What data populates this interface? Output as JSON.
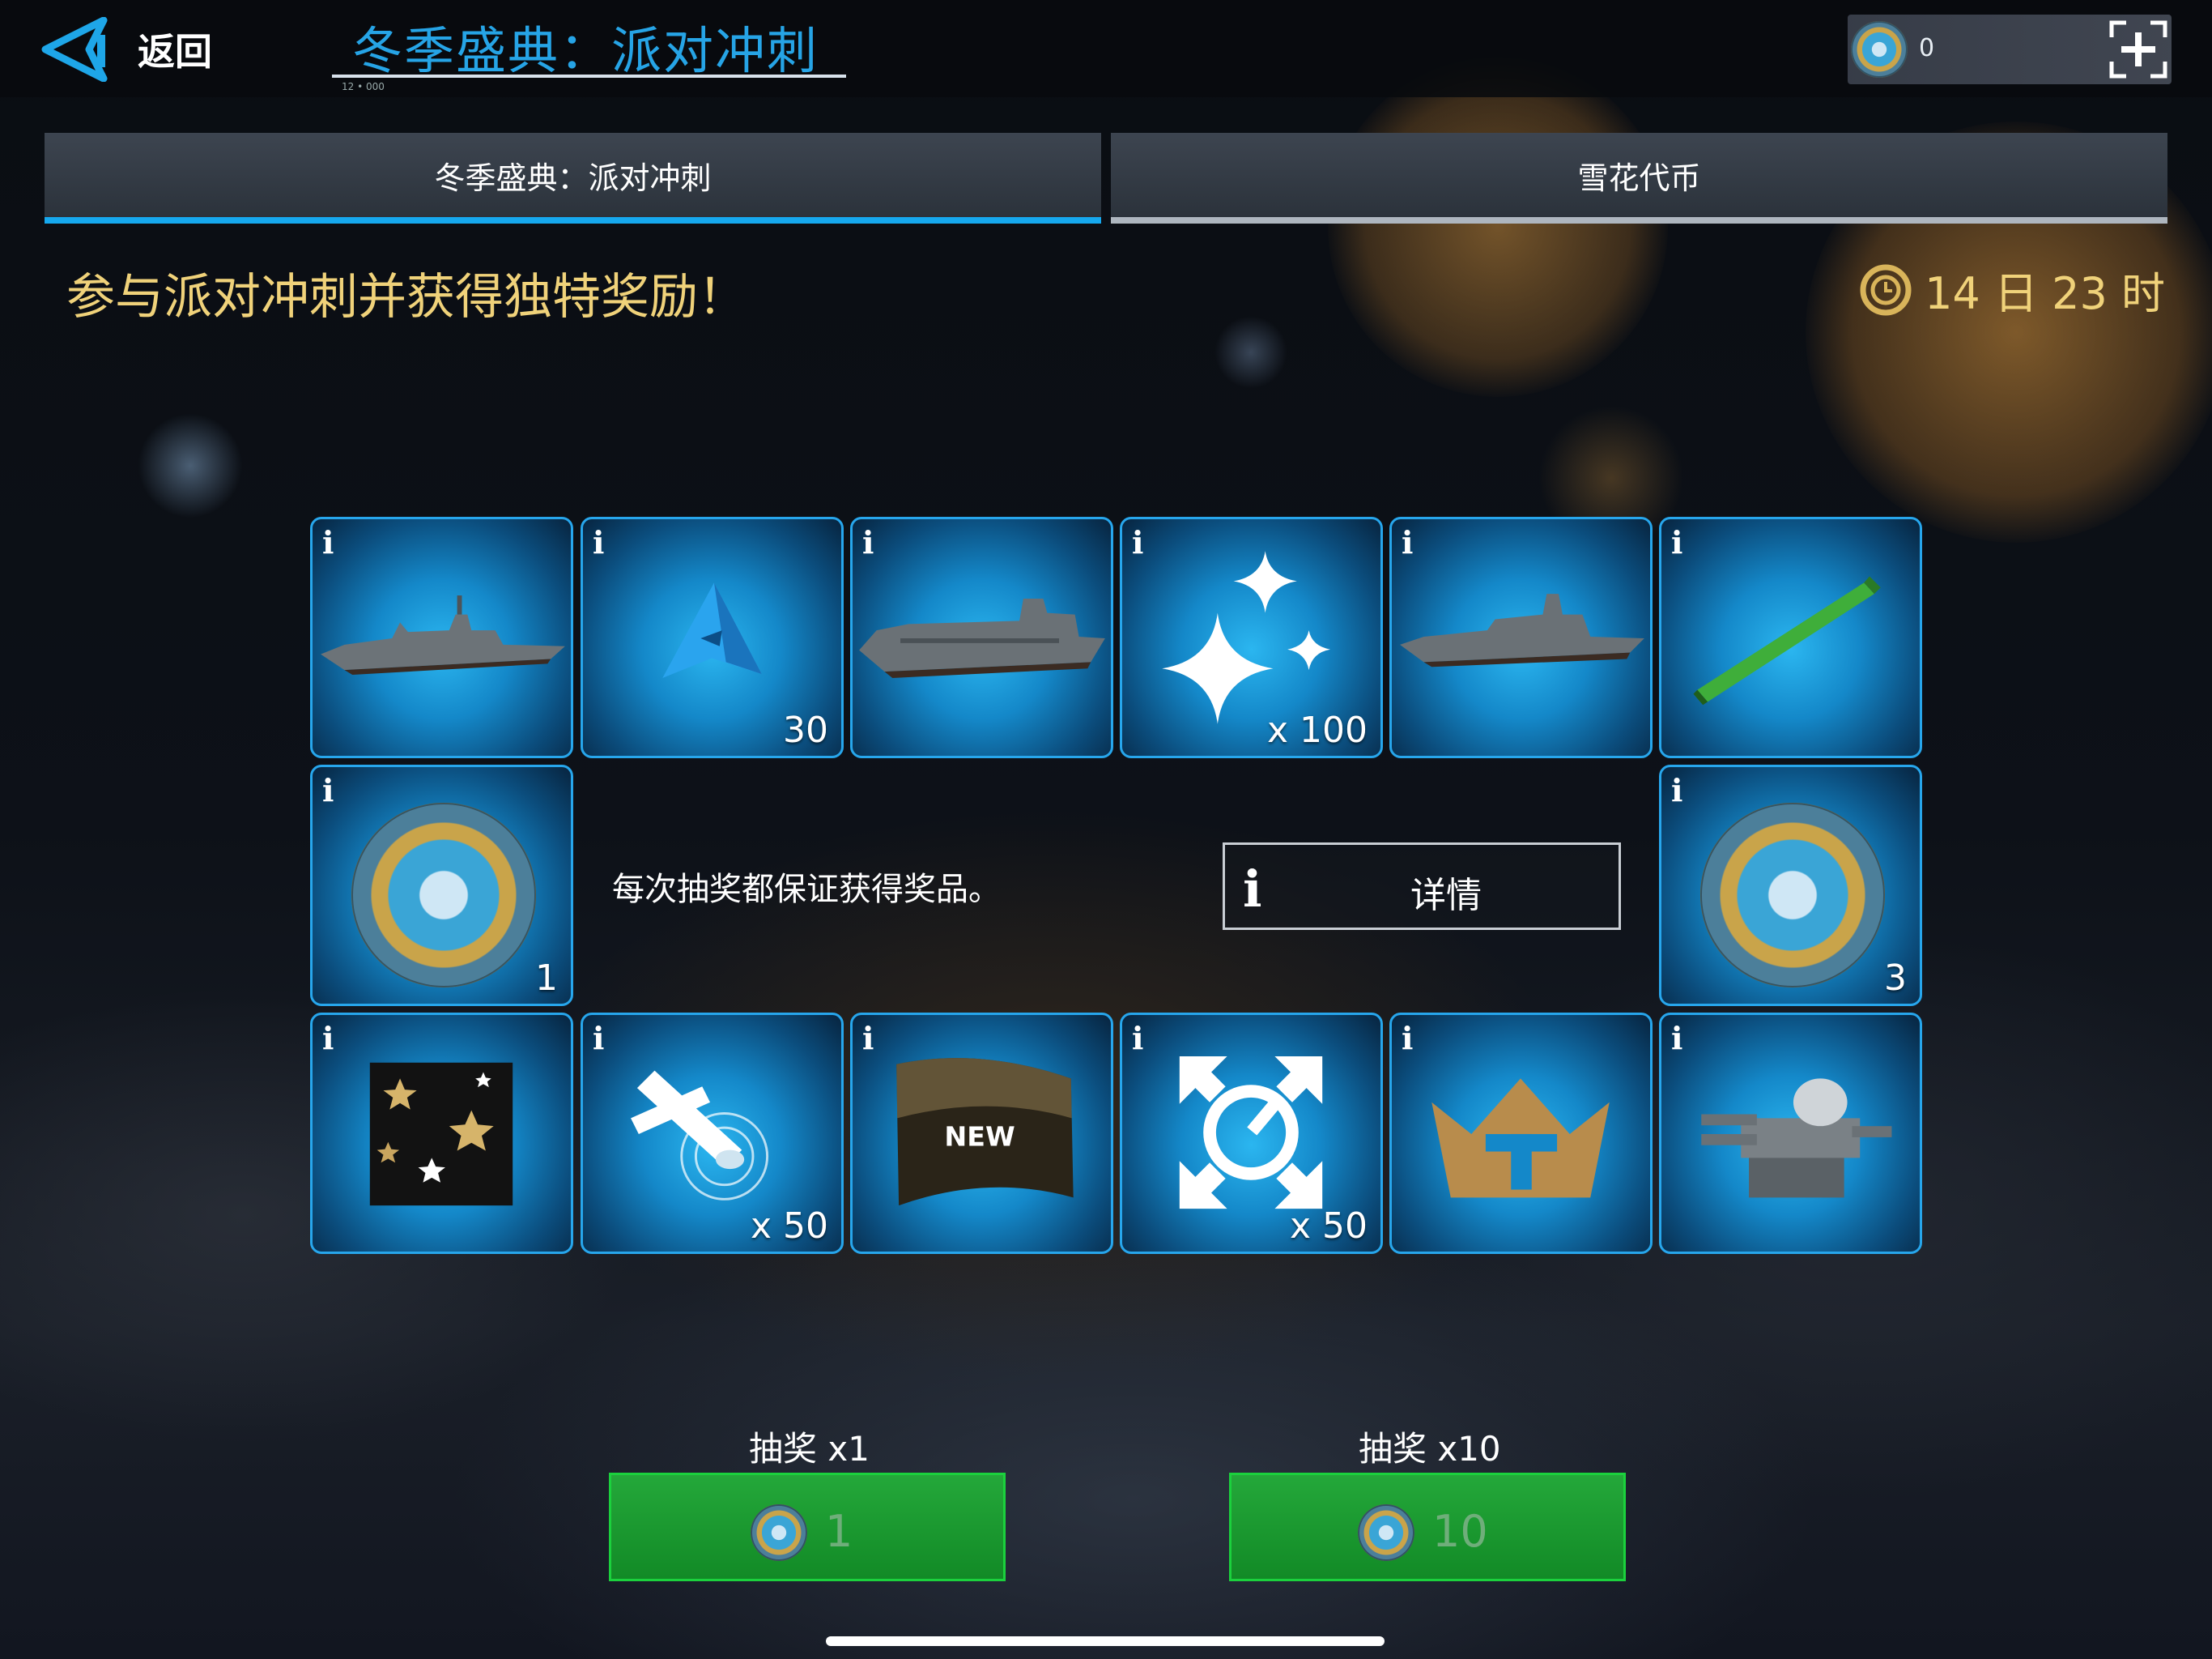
{
  "header": {
    "back_label": "返回",
    "title": "冬季盛典：派对冲刺",
    "title_sub": "12 • 000",
    "currency_value": "0"
  },
  "tabs": [
    {
      "label": "冬季盛典：派对冲刺",
      "active": true
    },
    {
      "label": "雪花代币",
      "active": false
    }
  ],
  "headline": "参与派对冲刺并获得独特奖励！",
  "timer": "14 日 23 时",
  "info_mark": "i",
  "rewards": {
    "row1": [
      {
        "item": "warship-1",
        "qty": ""
      },
      {
        "item": "blue-token",
        "qty": "30"
      },
      {
        "item": "aircraft-carrier",
        "qty": ""
      },
      {
        "item": "sparkles",
        "qty": "x 100"
      },
      {
        "item": "warship-2",
        "qty": ""
      },
      {
        "item": "green-torpedo",
        "qty": ""
      }
    ],
    "row2_left": {
      "item": "snowflake-coin",
      "qty": "1"
    },
    "row2_right": {
      "item": "snowflake-coin",
      "qty": "3"
    },
    "row3": [
      {
        "item": "star-camo",
        "qty": ""
      },
      {
        "item": "scope-boost",
        "qty": "x 50"
      },
      {
        "item": "happy-new-year-flag",
        "qty": ""
      },
      {
        "item": "repair-boost",
        "qty": "x 50"
      },
      {
        "item": "crown",
        "qty": ""
      },
      {
        "item": "turret",
        "qty": ""
      }
    ]
  },
  "guarantee_text": "每次抽奖都保证获得奖品。",
  "details_label": "详情",
  "draws": [
    {
      "label": "抽奖 x1",
      "cost": "1"
    },
    {
      "label": "抽奖 x10",
      "cost": "10"
    }
  ],
  "colors": {
    "accent": "#26a4e6",
    "gold": "#f0d27a",
    "green": "#1a9a30"
  }
}
